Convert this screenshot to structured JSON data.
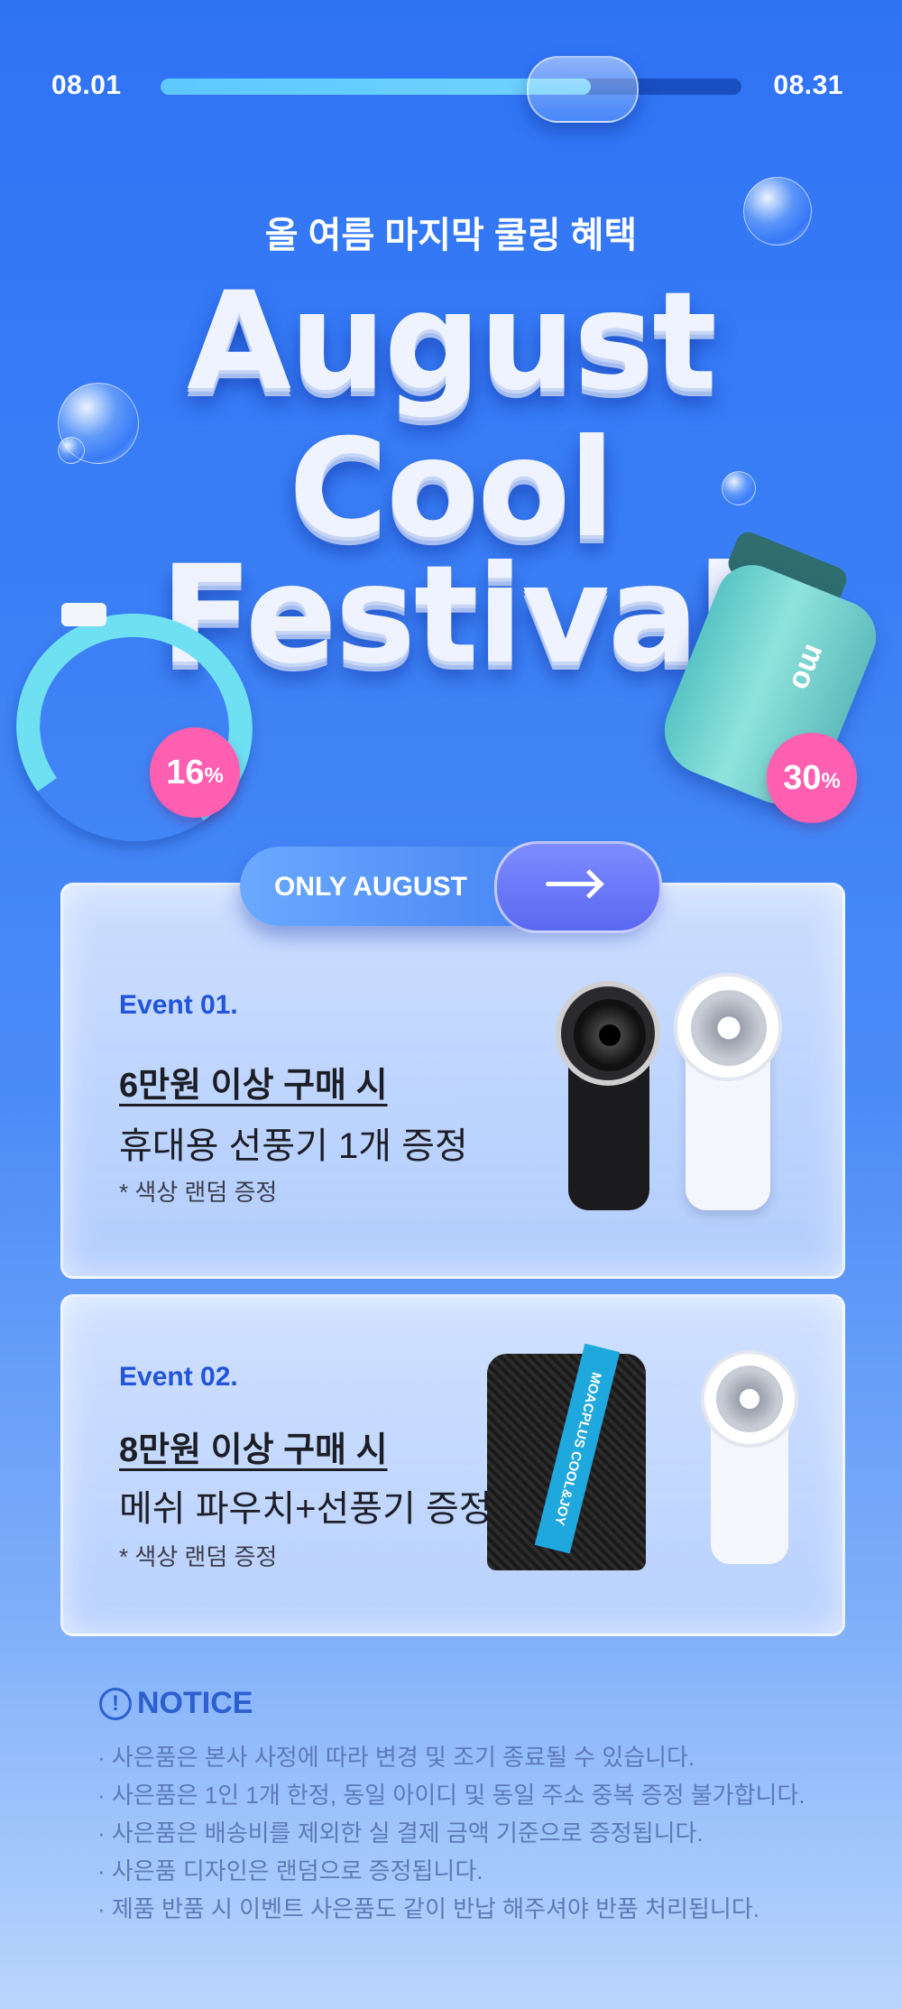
{
  "progress": {
    "start_date": "08.01",
    "end_date": "08.31",
    "fill_fraction": 0.74
  },
  "hero": {
    "subtitle": "올 여름 마지막 쿨링 혜택",
    "title_line1": "August",
    "title_line2": "Cool",
    "title_line3": "Festival"
  },
  "badges": {
    "left_value": "16",
    "right_value": "30",
    "unit": "%"
  },
  "bag": {
    "logo": "mo"
  },
  "only_august": {
    "label": "ONLY AUGUST"
  },
  "events": [
    {
      "tag": "Event 01.",
      "condition": "6만원 이상 구매 시",
      "gift": "휴대용 선풍기 1개 증정",
      "note": "* 색상 랜덤 증정"
    },
    {
      "tag": "Event 02.",
      "condition": "8만원 이상 구매 시",
      "gift": "메쉬 파우치+선풍기 증정",
      "note": "* 색상 랜덤 증정"
    }
  ],
  "pouch": {
    "strap_text": "MOACPLUS COOL&JOY"
  },
  "notice": {
    "icon": "!",
    "title": "NOTICE",
    "items": [
      "· 사은품은 본사 사정에 따라 변경 및 조기 종료될 수 있습니다.",
      "· 사은품은 1인 1개 한정, 동일 아이디 및 동일 주소 중복 증정 불가합니다.",
      "· 사은품은 배송비를 제외한 실 결제 금액 기준으로 증정됩니다.",
      "· 사은품 디자인은 랜덤으로 증정됩니다.",
      "· 제품 반품 시 이벤트 사은품도 같이 반납 해주셔야 반품 처리됩니다."
    ]
  },
  "colors": {
    "accent": "#2153dc",
    "badge": "#ff5fb0",
    "progress_fill": "#5ec8ff"
  }
}
